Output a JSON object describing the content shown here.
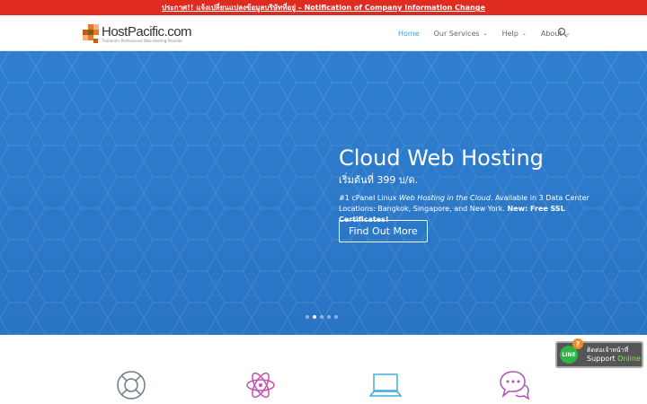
{
  "topbar": {
    "text": "ประกาศ!! แจ้งเปลี่ยนแปลงข้อมูลบริษัทที่อยู่ – Notification of Company Information Change"
  },
  "logo": {
    "name": "HostPacific.com",
    "tagline": "Thailand's Professional Web Hosting Provider"
  },
  "nav": {
    "items": [
      {
        "label": "Home",
        "dropdown": false,
        "active": true
      },
      {
        "label": "Our Services",
        "dropdown": true,
        "active": false
      },
      {
        "label": "Help",
        "dropdown": true,
        "active": false
      },
      {
        "label": "About",
        "dropdown": true,
        "active": false
      }
    ]
  },
  "hero": {
    "title": "Cloud Web Hosting",
    "subtitle": "เริ่มต้นที่ 399 บ/ด.",
    "desc_part1": "#1 cPanel Linux ",
    "desc_em": "Web Hosting in the Cloud",
    "desc_part2": ". Available in 3 Data Center Locations: Bangkok, Singapore, and New York. ",
    "desc_bold": "New: Free SSL Certificates!",
    "button_label": "Find Out More",
    "slides": 5,
    "active_slide": 2
  },
  "line_widget": {
    "badge": "LINE",
    "q_mark": "?",
    "top_text": "ติดต่อเจ้าหน้าที่",
    "bottom_text_1": "Support ",
    "bottom_text_2": "Online"
  },
  "colors": {
    "topbar": "#e02b20",
    "hero": "#2f7fd0",
    "nav_active": "#2ea3f2",
    "line_green": "#2cb742"
  }
}
